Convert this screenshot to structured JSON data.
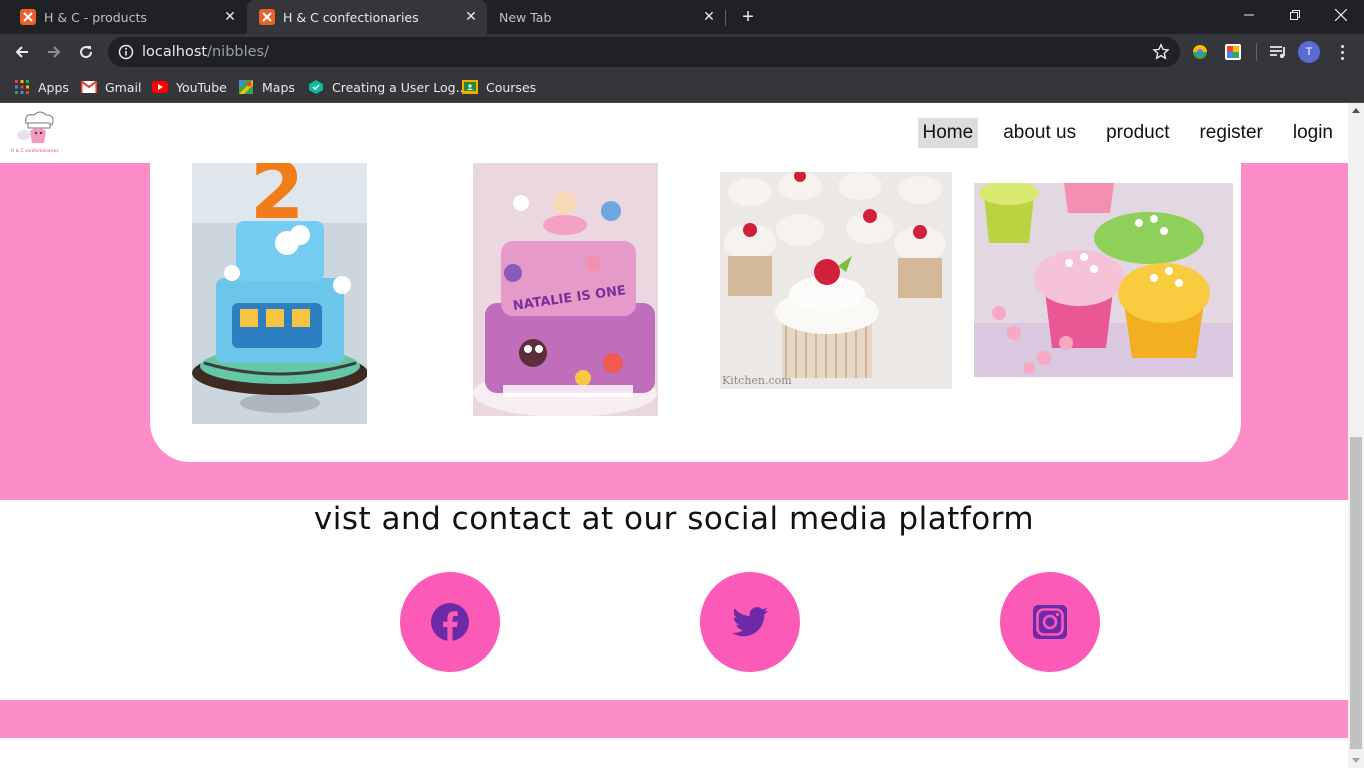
{
  "browser": {
    "tabs": [
      {
        "title": "H & C - products",
        "active": false
      },
      {
        "title": "H & C confectionaries",
        "active": true
      },
      {
        "title": "New Tab",
        "active": false
      }
    ],
    "address": {
      "host": "localhost",
      "path": "/nibbles/"
    },
    "profile_initial": "T",
    "bookmarks": [
      {
        "label": "Apps",
        "icon": "apps-grid-icon"
      },
      {
        "label": "Gmail",
        "icon": "gmail-icon"
      },
      {
        "label": "YouTube",
        "icon": "youtube-icon"
      },
      {
        "label": "Maps",
        "icon": "maps-icon"
      },
      {
        "label": "Creating a User Log...",
        "icon": "site-icon"
      },
      {
        "label": "Courses",
        "icon": "classroom-icon"
      }
    ]
  },
  "site": {
    "logo_icon": "chef-cupcake-logo",
    "nav": [
      {
        "label": "Home",
        "active": true
      },
      {
        "label": "about us",
        "active": false
      },
      {
        "label": "product",
        "active": false
      },
      {
        "label": "register",
        "active": false
      },
      {
        "label": "login",
        "active": false
      }
    ],
    "gallery": [
      {
        "name": "blue train birthday cake",
        "icon": "cake-photo"
      },
      {
        "name": "pink flower tiered cake",
        "icon": "cake-photo"
      },
      {
        "name": "strawberry cupcakes",
        "icon": "cupcake-photo"
      },
      {
        "name": "pastel flower cupcakes",
        "icon": "cupcake-photo"
      }
    ],
    "photo_caption": "Kitchen.com",
    "social": {
      "title": "vist and contact at our social media platform",
      "links": [
        {
          "name": "facebook",
          "icon": "facebook-icon"
        },
        {
          "name": "twitter",
          "icon": "twitter-icon"
        },
        {
          "name": "instagram",
          "icon": "instagram-icon"
        }
      ]
    },
    "colors": {
      "pink_band": "#fd8dc9",
      "social_circle": "#fb5bb7",
      "icon_purple": "#6d2aa8"
    }
  }
}
